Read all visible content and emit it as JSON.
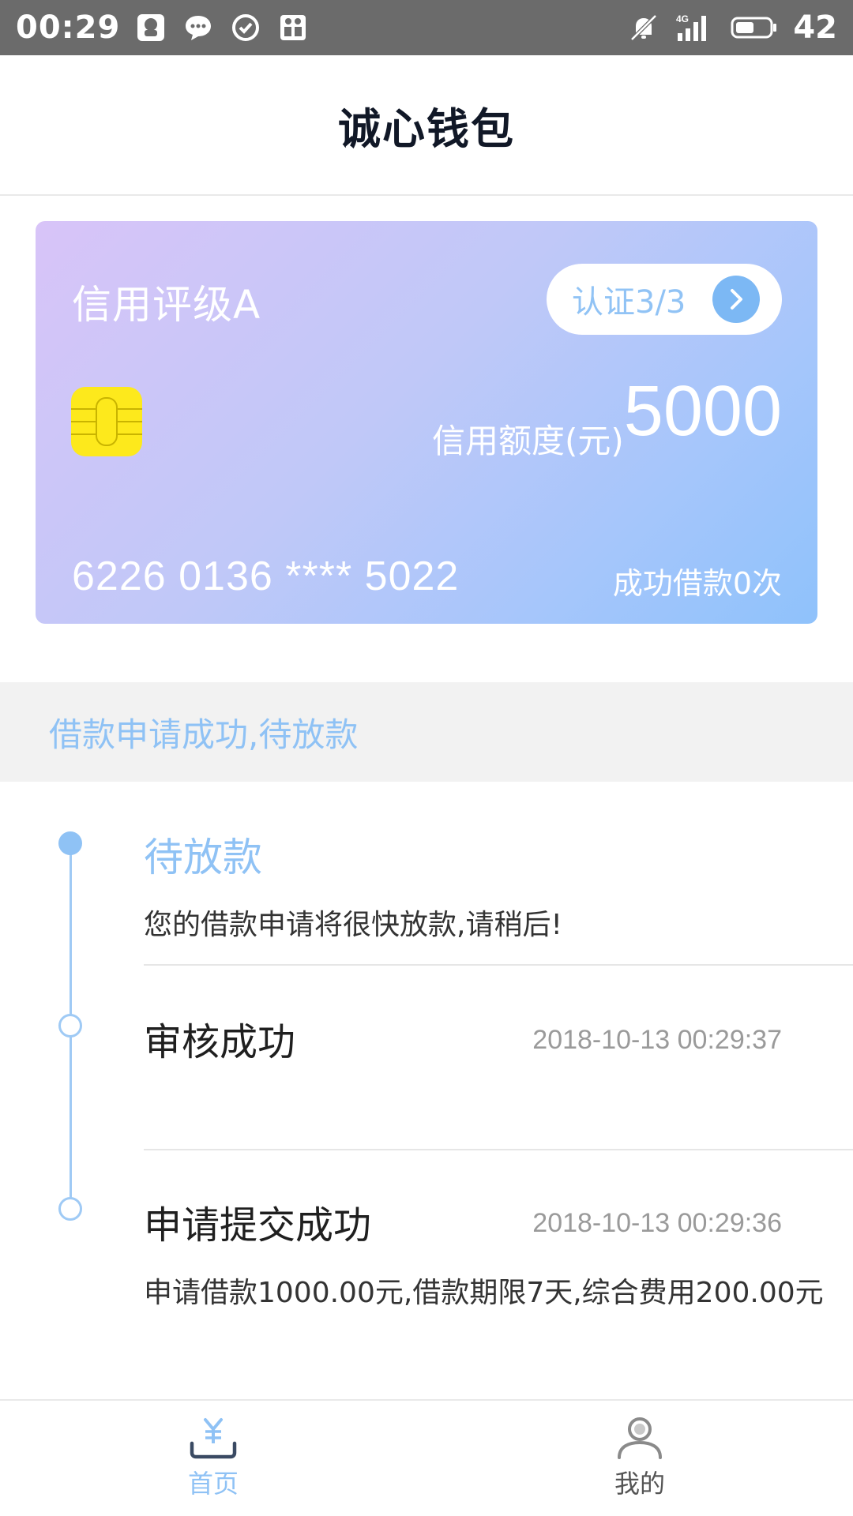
{
  "status_bar": {
    "time": "00:29",
    "battery_level": "42",
    "network": "4G"
  },
  "header": {
    "title": "诚心钱包"
  },
  "card": {
    "credit_rating": "信用评级A",
    "certification": "认证3/3",
    "credit_limit_label": "信用额度(元)",
    "credit_limit_value": "5000",
    "card_number": "6226 0136 **** 5022",
    "loan_count": "成功借款0次"
  },
  "banner": {
    "text": "借款申请成功,待放款"
  },
  "timeline": {
    "steps": [
      {
        "title": "待放款",
        "description": "您的借款申请将很快放款,请稍后!"
      },
      {
        "title": "审核成功",
        "time": "2018-10-13 00:29:37"
      },
      {
        "title": "申请提交成功",
        "time": "2018-10-13 00:29:36",
        "description": "申请借款1000.00元,借款期限7天,综合费用200.00元"
      }
    ]
  },
  "bottom_nav": {
    "items": [
      {
        "label": "首页",
        "icon": "yuan-tray-icon",
        "active": true
      },
      {
        "label": "我的",
        "icon": "user-icon",
        "active": false
      }
    ]
  },
  "colors": {
    "accent": "#8fc2f5",
    "status_bar": "#6b6b6b",
    "chip": "#fde91c"
  }
}
